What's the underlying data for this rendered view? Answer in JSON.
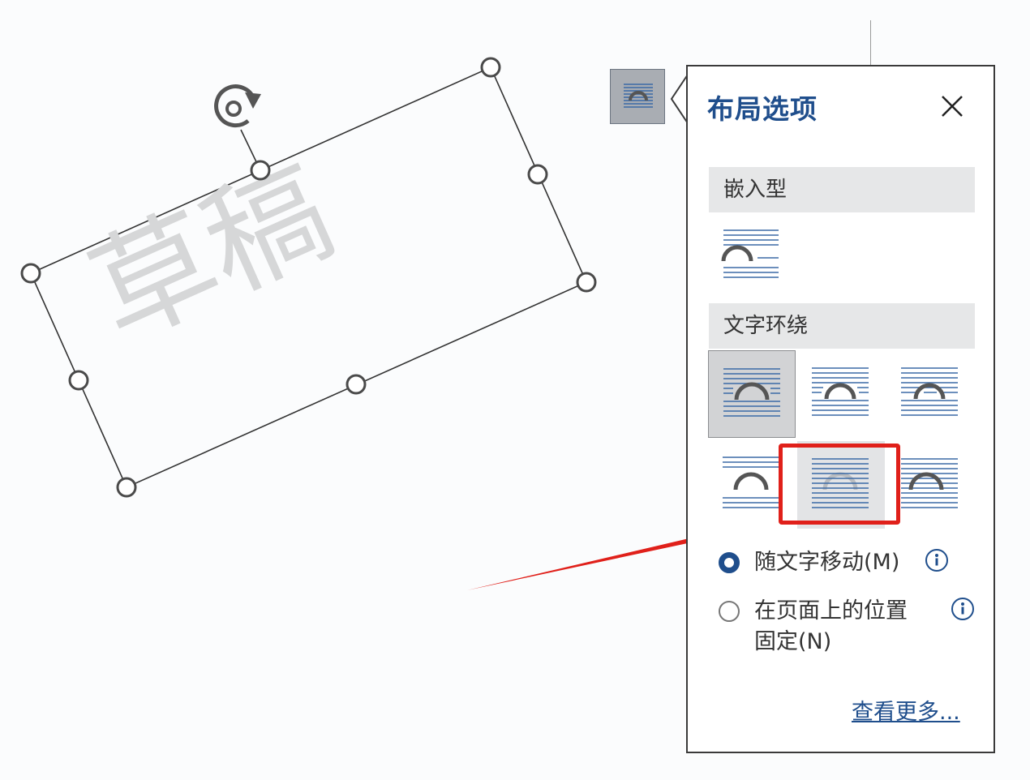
{
  "document": {
    "watermark_text": "草稿"
  },
  "layout_panel": {
    "title": "布局选项",
    "sections": {
      "inline": "嵌入型",
      "text_wrapping": "文字环绕"
    },
    "options": {
      "move_with_text": "随文字移动(M)",
      "fix_position_line1": "在页面上的位置",
      "fix_position_line2": "固定(N)",
      "selected": "move_with_text"
    },
    "see_more": "查看更多..."
  },
  "colors": {
    "accent": "#1f4e8c",
    "highlight": "#e0201a"
  }
}
